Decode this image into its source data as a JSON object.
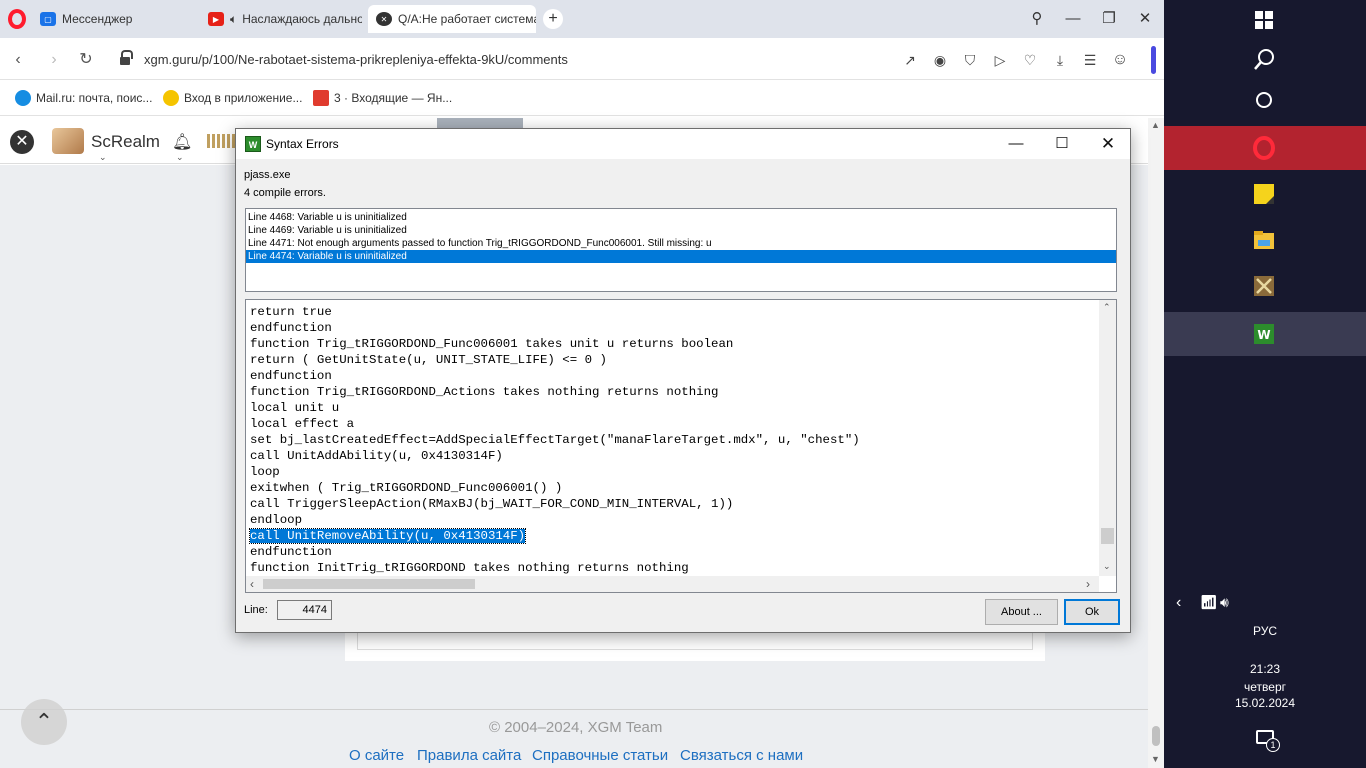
{
  "browser": {
    "tabs": [
      {
        "label": "Мессенджер"
      },
      {
        "label": "Наслаждаюсь дально"
      },
      {
        "label": "Q/A:Не работает система"
      }
    ],
    "url": "xgm.guru/p/100/Ne-rabotaet-sistema-prikrepleniya-effekta-9kU/comments",
    "bookmarks": [
      {
        "label": "Mail.ru: почта, поис..."
      },
      {
        "label": "Вход в приложение..."
      },
      {
        "label": "3 · Входящие — Ян..."
      }
    ]
  },
  "page": {
    "username": "ScRealm",
    "copyright": "© 2004–2024, XGM Team",
    "footer_links": [
      {
        "label": "О сайте"
      },
      {
        "label": "Правила сайта"
      },
      {
        "label": "Справочные статьи"
      },
      {
        "label": "Связаться с нами"
      }
    ]
  },
  "dialog": {
    "title": "Syntax Errors",
    "exe": "pjass.exe",
    "compile_summary": "4 compile errors.",
    "errors": [
      {
        "text": "Line 4468:  Variable u is uninitialized"
      },
      {
        "text": "Line 4469:  Variable u is uninitialized"
      },
      {
        "text": "Line 4471:  Not enough arguments passed to function Trig_tRIGGORDOND_Func006001. Still missing: u"
      },
      {
        "text": "Line 4474:  Variable u is uninitialized"
      }
    ],
    "selected_error_index": 3,
    "code_lines": [
      {
        "text": "return true"
      },
      {
        "text": "endfunction"
      },
      {
        "text": "function Trig_tRIGGORDOND_Func006001 takes unit u returns boolean"
      },
      {
        "text": "return ( GetUnitState(u, UNIT_STATE_LIFE) <= 0 )"
      },
      {
        "text": "endfunction"
      },
      {
        "text": "function Trig_tRIGGORDOND_Actions takes nothing returns nothing"
      },
      {
        "text": "local unit u"
      },
      {
        "text": "local effect a"
      },
      {
        "text": "set bj_lastCreatedEffect=AddSpecialEffectTarget(\"manaFlareTarget.mdx\", u, \"chest\")"
      },
      {
        "text": "call UnitAddAbility(u, 0x4130314F)"
      },
      {
        "text": "loop"
      },
      {
        "text": "exitwhen ( Trig_tRIGGORDOND_Func006001() )"
      },
      {
        "text": "call TriggerSleepAction(RMaxBJ(bj_WAIT_FOR_COND_MIN_INTERVAL, 1))"
      },
      {
        "text": "endloop"
      },
      {
        "text": "call UnitRemoveAbility(u, 0x4130314F)"
      },
      {
        "text": "endfunction"
      },
      {
        "text": "function InitTrig_tRIGGORDOND takes nothing returns nothing"
      }
    ],
    "selected_code_index": 14,
    "line_label": "Line:",
    "line_value": "4474",
    "about_label": "About ...",
    "ok_label": "Ok"
  },
  "taskbar": {
    "language": "РУС",
    "time": "21:23",
    "weekday": "четверг",
    "date": "15.02.2024",
    "notification_count": "1"
  },
  "colors": {
    "selection": "#0078d7",
    "taskbar_bg": "#17182e",
    "opera_red": "#ff1b2d",
    "link": "#1d6fc1"
  }
}
